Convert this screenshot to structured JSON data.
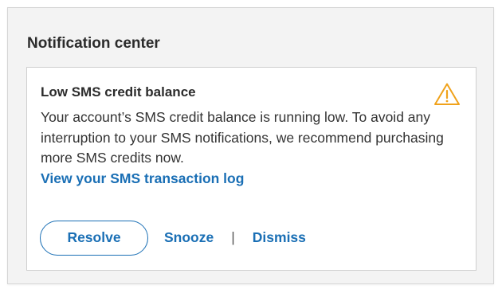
{
  "panel": {
    "title": "Notification center"
  },
  "notification": {
    "title": "Low SMS credit balance",
    "icon": "warning-icon",
    "icon_color": "#f0a21b",
    "message": "Your account’s SMS credit balance is running low. To avoid any interruption to your SMS notifications, we recommend purchasing more SMS credits now.",
    "link_label": "View your SMS transaction log",
    "actions": {
      "resolve_label": "Resolve",
      "snooze_label": "Snooze",
      "separator": "|",
      "dismiss_label": "Dismiss"
    }
  },
  "colors": {
    "accent": "#1a6fb5",
    "panel_bg": "#f3f3f3",
    "card_bg": "#ffffff",
    "text": "#333333"
  }
}
